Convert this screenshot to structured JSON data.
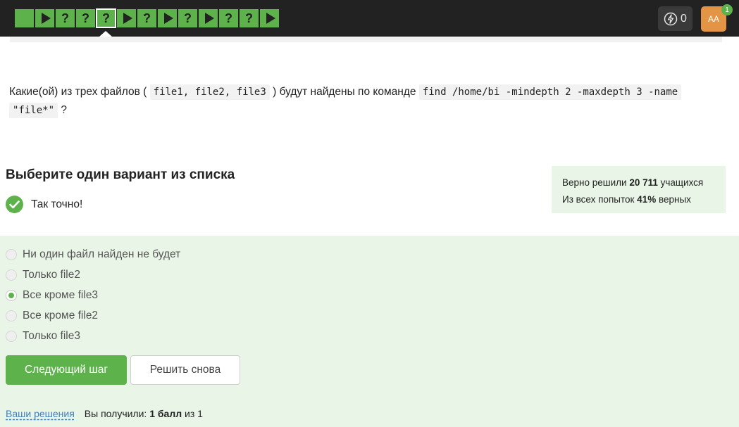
{
  "steps": [
    {
      "kind": "blank",
      "label": ""
    },
    {
      "kind": "play",
      "label": ""
    },
    {
      "kind": "question",
      "label": "?"
    },
    {
      "kind": "question",
      "label": "?"
    },
    {
      "kind": "question",
      "label": "?",
      "active": true
    },
    {
      "kind": "play",
      "label": ""
    },
    {
      "kind": "question",
      "label": "?"
    },
    {
      "kind": "play",
      "label": ""
    },
    {
      "kind": "question",
      "label": "?"
    },
    {
      "kind": "play",
      "label": ""
    },
    {
      "kind": "question",
      "label": "?"
    },
    {
      "kind": "question",
      "label": "?"
    },
    {
      "kind": "play",
      "label": ""
    }
  ],
  "header": {
    "energy_count": "0",
    "avatar_initials": "AA",
    "notification_count": "1"
  },
  "question": {
    "part1": "Какие(ой) из трех файлов (",
    "code1": "file1, file2, file3",
    "part2": ") будут найдены по команде",
    "code2": "find /home/bi -mindepth 2 -maxdepth 3 -name",
    "code3": "\"file*\"",
    "part3": "?"
  },
  "task": {
    "subtitle": "Выберите один вариант из списка",
    "result": "Так точно!"
  },
  "stats": {
    "line1_prefix": "Верно решили",
    "line1_value": "20 711",
    "line1_suffix": "учащихся",
    "line2_prefix": "Из всех попыток",
    "line2_value": "41%",
    "line2_suffix": "верных"
  },
  "options": [
    {
      "label": "Ни один файл найден не будет",
      "checked": false
    },
    {
      "label": "Только file2",
      "checked": false
    },
    {
      "label": "Все кроме file3",
      "checked": true
    },
    {
      "label": "Все кроме file2",
      "checked": false
    },
    {
      "label": "Только file3",
      "checked": false
    }
  ],
  "buttons": {
    "next": "Следующий шаг",
    "retry": "Решить снова"
  },
  "footer": {
    "solutions_link": "Ваши решения",
    "score_prefix": "Вы получили:",
    "score_value": "1 балл",
    "score_suffix": "из 1"
  },
  "colors": {
    "accent": "#5eb24b",
    "topbar": "#222222",
    "answer_bg": "#e9f5e6",
    "avatar": "#e39445",
    "link": "#3c7fc0"
  },
  "icons": {
    "energy": "lightning-bolt-icon",
    "result": "check-circle-icon",
    "play_step": "play-icon"
  }
}
